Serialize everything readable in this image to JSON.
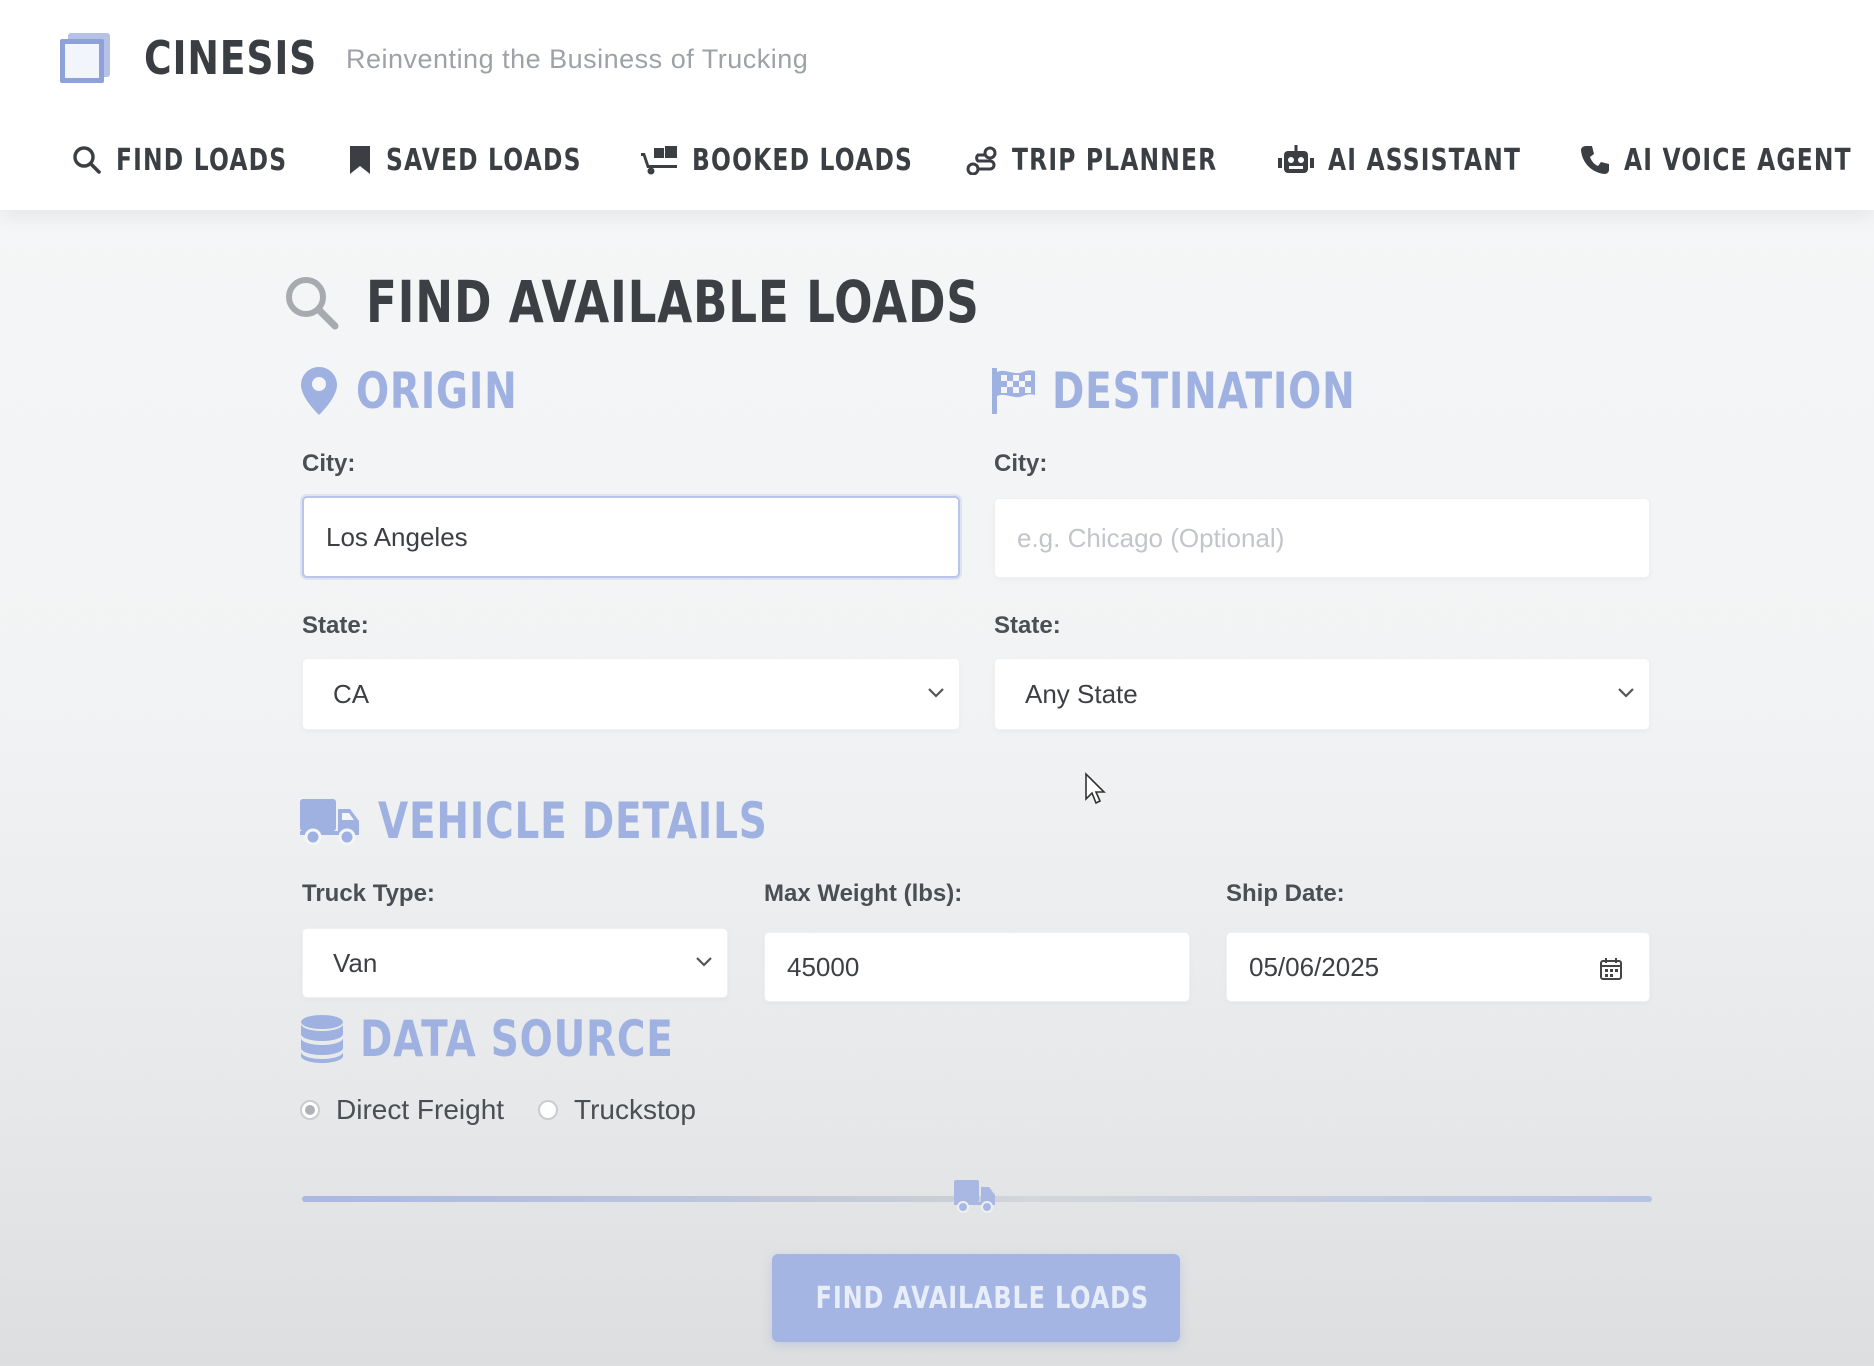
{
  "app": {
    "name": "CINESIS",
    "tagline": "Reinventing the Business of Trucking"
  },
  "nav": {
    "items": [
      {
        "label": "FIND LOADS",
        "icon": "search-icon"
      },
      {
        "label": "SAVED LOADS",
        "icon": "bookmark-icon"
      },
      {
        "label": "BOOKED LOADS",
        "icon": "truck-loading-icon"
      },
      {
        "label": "TRIP PLANNER",
        "icon": "route-icon"
      },
      {
        "label": "AI ASSISTANT",
        "icon": "robot-icon"
      },
      {
        "label": "AI VOICE AGENT",
        "icon": "phone-icon"
      }
    ]
  },
  "page": {
    "title": "FIND AVAILABLE LOADS"
  },
  "origin": {
    "heading": "ORIGIN",
    "city_label": "City:",
    "city_value": "Los Angeles",
    "state_label": "State:",
    "state_value": "CA"
  },
  "destination": {
    "heading": "DESTINATION",
    "city_label": "City:",
    "city_placeholder": "e.g. Chicago (Optional)",
    "state_label": "State:",
    "state_value": "Any State"
  },
  "vehicle": {
    "heading": "VEHICLE DETAILS",
    "truck_type_label": "Truck Type:",
    "truck_type_value": "Van",
    "max_weight_label": "Max Weight (lbs):",
    "max_weight_value": "45000",
    "ship_date_label": "Ship Date:",
    "ship_date_value": "05/06/2025"
  },
  "data_source": {
    "heading": "DATA SOURCE",
    "options": [
      {
        "label": "Direct Freight",
        "checked": true
      },
      {
        "label": "Truckstop",
        "checked": false
      }
    ]
  },
  "search_button": {
    "label": "FIND AVAILABLE LOADS"
  },
  "colors": {
    "accent": "#9fb1e0",
    "button": "#a4b5e3",
    "heading_dark": "#3c3f44"
  }
}
